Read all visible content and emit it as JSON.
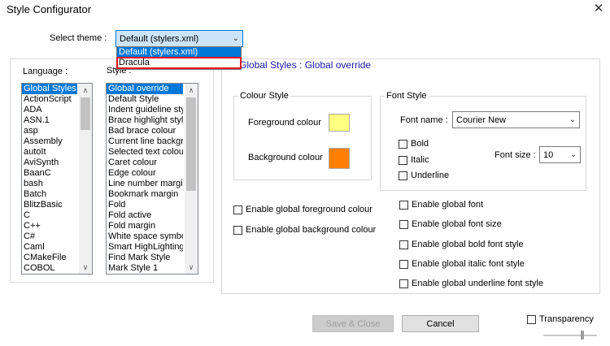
{
  "window": {
    "title": "Style Configurator",
    "close_icon": "close-icon"
  },
  "theme": {
    "label": "Select theme :",
    "value": "Default (stylers.xml)",
    "options": [
      "Default (stylers.xml)",
      "Dracula"
    ]
  },
  "language": {
    "label": "Language :",
    "items": [
      "Global Styles",
      "ActionScript",
      "ADA",
      "ASN.1",
      "asp",
      "Assembly",
      "autoIt",
      "AviSynth",
      "BaanC",
      "bash",
      "Batch",
      "BlitzBasic",
      "C",
      "C++",
      "C#",
      "Caml",
      "CMakeFile",
      "COBOL"
    ]
  },
  "style": {
    "label": "Style :",
    "items": [
      "Global override",
      "Default Style",
      "Indent guideline style",
      "Brace highlight style",
      "Bad brace colour",
      "Current line background",
      "Selected text colour",
      "Caret colour",
      "Edge colour",
      "Line number margin",
      "Bookmark margin",
      "Fold",
      "Fold active",
      "Fold margin",
      "White space symbol",
      "Smart HighLighting",
      "Find Mark Style",
      "Mark Style 1"
    ]
  },
  "panel": {
    "heading": "Global Styles : Global override"
  },
  "colour_style": {
    "legend": "Colour Style",
    "foreground_label": "Foreground colour",
    "background_label": "Background colour",
    "foreground_color": "#ffff80",
    "background_color": "#ff8000"
  },
  "font_style": {
    "legend": "Font Style",
    "name_label": "Font name :",
    "name_value": "Courier New",
    "size_label": "Font size :",
    "size_value": "10",
    "bold": "Bold",
    "italic": "Italic",
    "underline": "Underline"
  },
  "enable": {
    "fg_colour": "Enable global foreground colour",
    "bg_colour": "Enable global background colour",
    "font": "Enable global font",
    "font_size": "Enable global font size",
    "bold": "Enable global bold font style",
    "italic": "Enable global italic font style",
    "underline": "Enable global underline font style"
  },
  "buttons": {
    "save_close": "Save & Close",
    "cancel": "Cancel"
  },
  "transparency": {
    "label": "Transparency"
  }
}
